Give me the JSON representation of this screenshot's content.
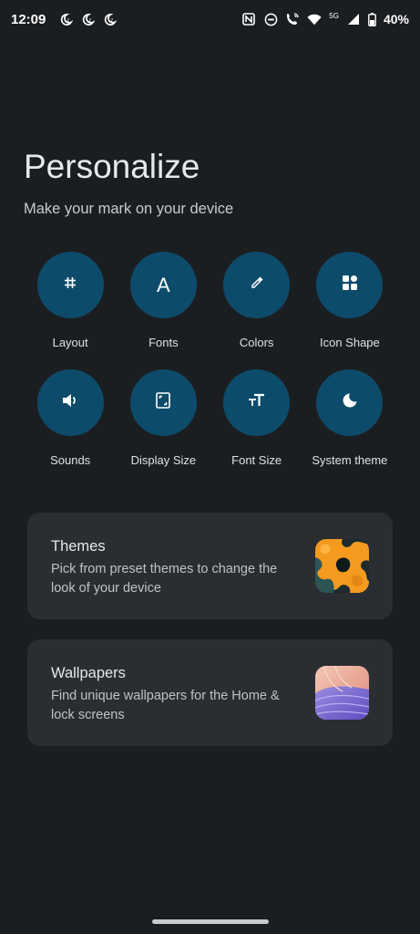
{
  "status_bar": {
    "time": "12:09",
    "network_label": "5G",
    "battery": "40%"
  },
  "header": {
    "title": "Personalize",
    "subtitle": "Make your mark on your device"
  },
  "options": [
    {
      "label": "Layout",
      "icon": "grid-icon"
    },
    {
      "label": "Fonts",
      "icon": "font-icon",
      "glyph": "A"
    },
    {
      "label": "Colors",
      "icon": "eyedropper-icon"
    },
    {
      "label": "Icon Shape",
      "icon": "icon-shape-icon"
    },
    {
      "label": "Sounds",
      "icon": "volume-icon"
    },
    {
      "label": "Display Size",
      "icon": "display-size-icon"
    },
    {
      "label": "Font Size",
      "icon": "font-size-icon"
    },
    {
      "label": "System theme",
      "icon": "moon-icon"
    }
  ],
  "cards": {
    "themes": {
      "title": "Themes",
      "description": "Pick from preset themes to change the look of your device"
    },
    "wallpapers": {
      "title": "Wallpapers",
      "description": "Find unique wallpapers for the Home & lock screens"
    }
  },
  "colors": {
    "background": "#1b1e21",
    "circle": "#0d4b6b",
    "card": "#2a2d31"
  }
}
